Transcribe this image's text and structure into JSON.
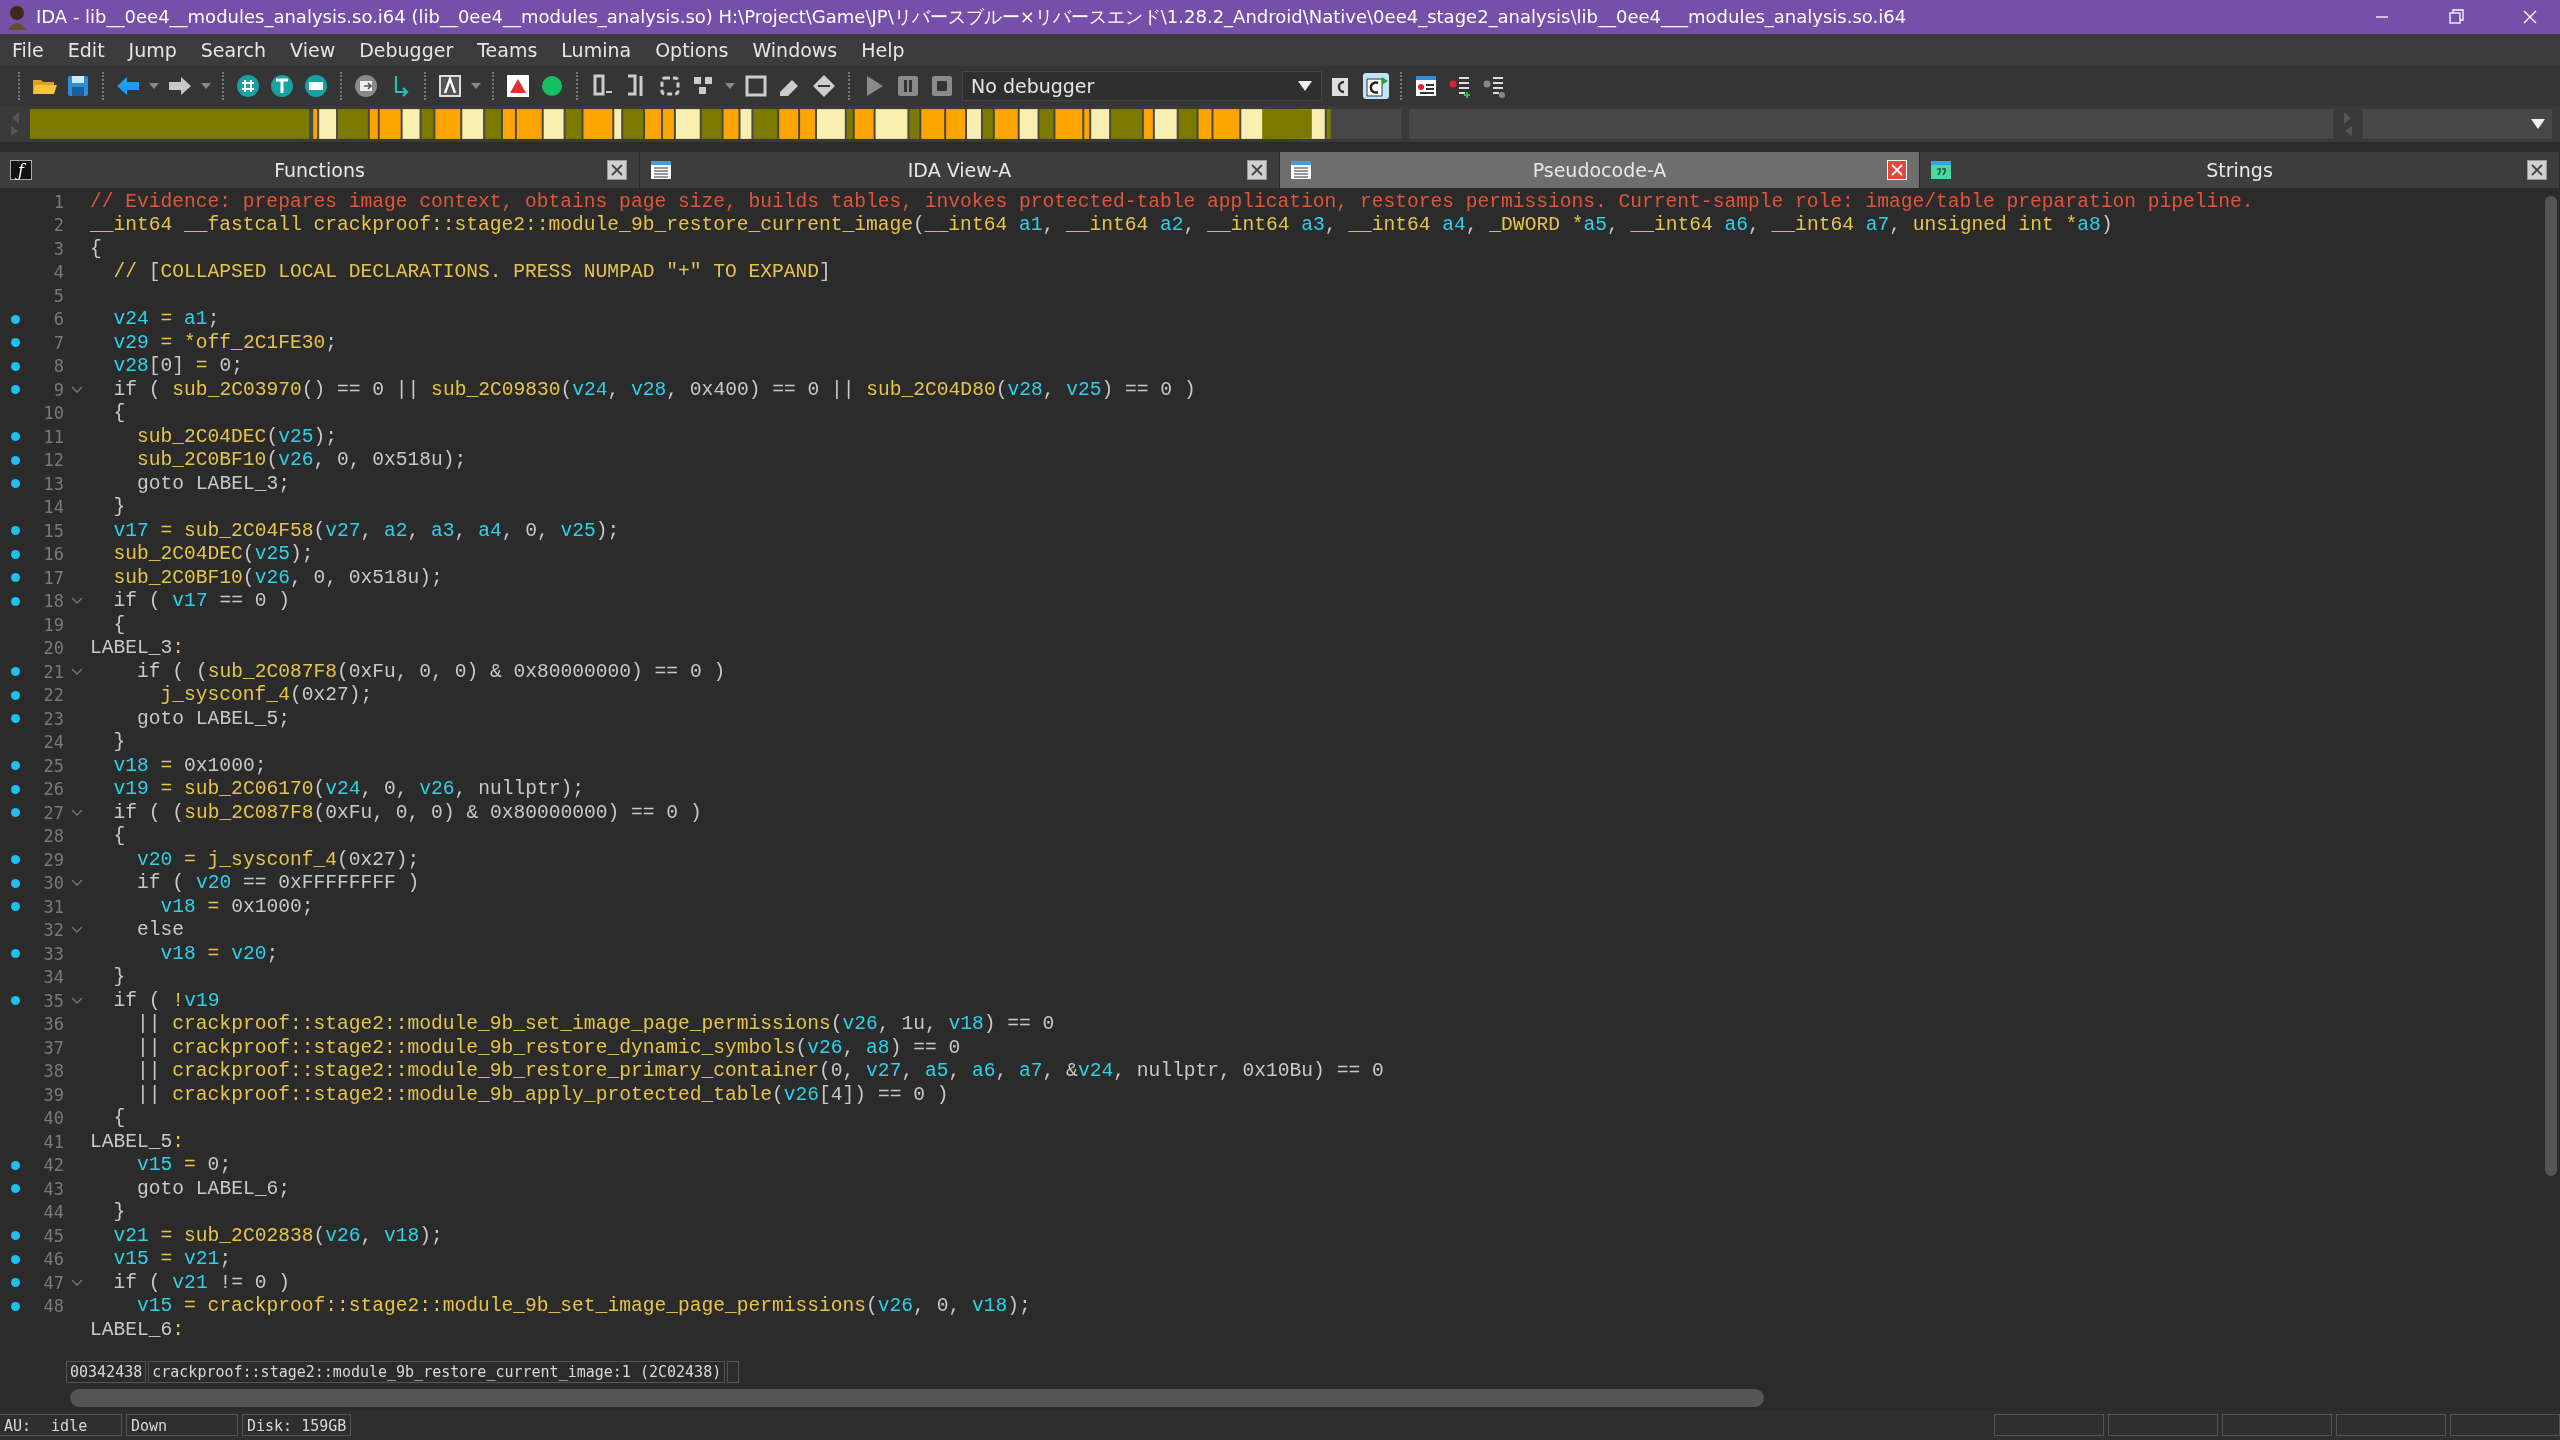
{
  "window": {
    "title": "IDA - lib__0ee4__modules_analysis.so.i64 (lib__0ee4__modules_analysis.so) H:\\Project\\Game\\JP\\リバースブルー×リバースエンド\\1.28.2_Android\\Native\\0ee4_stage2_analysis\\lib__0ee4___modules_analysis.so.i64"
  },
  "menu": [
    "File",
    "Edit",
    "Jump",
    "Search",
    "View",
    "Debugger",
    "Teams",
    "Lumina",
    "Options",
    "Windows",
    "Help"
  ],
  "toolbar": {
    "debugger": "No debugger"
  },
  "tabs": [
    {
      "label": "Functions",
      "kind": "functions",
      "glyph": "ƒ",
      "selected": false
    },
    {
      "label": "IDA View-A",
      "kind": "listing",
      "selected": false
    },
    {
      "label": "Pseudocode-A",
      "kind": "listing",
      "selected": true
    },
    {
      "label": "Strings",
      "kind": "strings",
      "selected": false
    }
  ],
  "code": {
    "lines": [
      {
        "number": "1",
        "kind": "comment",
        "text": "// Evidence: prepares image context, obtains page size, builds tables, invokes protected-table application, restores permissions. Current-sample role: image/table preparation pipeline.",
        "marked": false,
        "foldable": false
      },
      {
        "number": "2",
        "kind": "code",
        "text": "__int64 __fastcall crackproof::stage2::module_9b_restore_current_image(__int64 a1, __int64 a2, __int64 a3, __int64 a4, _DWORD *a5, __int64 a6, __int64 a7, unsigned int *a8)",
        "marked": false,
        "foldable": false
      },
      {
        "number": "3",
        "kind": "code",
        "text": "{",
        "marked": false,
        "foldable": false
      },
      {
        "number": "4",
        "kind": "code",
        "text": "  // [COLLAPSED LOCAL DECLARATIONS. PRESS NUMPAD \"+\" TO EXPAND]",
        "marked": false,
        "foldable": false
      },
      {
        "number": "5",
        "marked": false,
        "foldable": false
      },
      {
        "number": "6",
        "kind": "code",
        "text": "  v24 = a1;",
        "marked": true,
        "foldable": false
      },
      {
        "number": "7",
        "kind": "code",
        "text": "  v29 = *off_2C1FE30;",
        "marked": true,
        "foldable": false
      },
      {
        "number": "8",
        "kind": "code",
        "text": "  v28[0] = 0;",
        "marked": true,
        "foldable": false
      },
      {
        "number": "9",
        "kind": "code",
        "text": "  if ( sub_2C03970() == 0 || sub_2C09830(v24, v28, 0x400) == 0 || sub_2C04D80(v28, v25) == 0 )",
        "marked": true,
        "foldable": true
      },
      {
        "number": "10",
        "kind": "code",
        "text": "  {",
        "marked": false,
        "foldable": false
      },
      {
        "number": "11",
        "kind": "code",
        "text": "    sub_2C04DEC(v25);",
        "marked": true,
        "foldable": false
      },
      {
        "number": "12",
        "kind": "code",
        "text": "    sub_2C0BF10(v26, 0, 0x518u);",
        "marked": true,
        "foldable": false
      },
      {
        "number": "13",
        "kind": "code",
        "text": "    goto LABEL_3;",
        "marked": true,
        "foldable": false
      },
      {
        "number": "14",
        "kind": "code",
        "text": "  }",
        "marked": false,
        "foldable": false
      },
      {
        "number": "15",
        "kind": "code",
        "text": "  v17 = sub_2C04F58(v27, a2, a3, a4, 0, v25);",
        "marked": true,
        "foldable": false
      },
      {
        "number": "16",
        "kind": "code",
        "text": "  sub_2C04DEC(v25);",
        "marked": true,
        "foldable": false
      },
      {
        "number": "17",
        "kind": "code",
        "text": "  sub_2C0BF10(v26, 0, 0x518u);",
        "marked": true,
        "foldable": false
      },
      {
        "number": "18",
        "kind": "code",
        "text": "  if ( v17 == 0 )",
        "marked": true,
        "foldable": true
      },
      {
        "number": "19",
        "kind": "code",
        "text": "  {",
        "marked": false,
        "foldable": false
      },
      {
        "number": "20",
        "kind": "code",
        "text": "LABEL_3:",
        "marked": false,
        "foldable": false
      },
      {
        "number": "21",
        "kind": "code",
        "text": "    if ( (sub_2C087F8(0xFu, 0, 0) & 0x80000000) == 0 )",
        "marked": true,
        "foldable": true
      },
      {
        "number": "22",
        "kind": "code",
        "text": "      j_sysconf_4(0x27);",
        "marked": true,
        "foldable": false
      },
      {
        "number": "23",
        "kind": "code",
        "text": "    goto LABEL_5;",
        "marked": true,
        "foldable": false
      },
      {
        "number": "24",
        "kind": "code",
        "text": "  }",
        "marked": false,
        "foldable": false
      },
      {
        "number": "25",
        "kind": "code",
        "text": "  v18 = 0x1000;",
        "marked": true,
        "foldable": false
      },
      {
        "number": "26",
        "kind": "code",
        "text": "  v19 = sub_2C06170(v24, 0, v26, nullptr);",
        "marked": true,
        "foldable": false
      },
      {
        "number": "27",
        "kind": "code",
        "text": "  if ( (sub_2C087F8(0xFu, 0, 0) & 0x80000000) == 0 )",
        "marked": true,
        "foldable": true
      },
      {
        "number": "28",
        "kind": "code",
        "text": "  {",
        "marked": false,
        "foldable": false
      },
      {
        "number": "29",
        "kind": "code",
        "text": "    v20 = j_sysconf_4(0x27);",
        "marked": true,
        "foldable": false
      },
      {
        "number": "30",
        "kind": "code",
        "text": "    if ( v20 == 0xFFFFFFFF )",
        "marked": true,
        "foldable": true
      },
      {
        "number": "31",
        "kind": "code",
        "text": "      v18 = 0x1000;",
        "marked": true,
        "foldable": false
      },
      {
        "number": "32",
        "kind": "code",
        "text": "    else",
        "marked": false,
        "foldable": true
      },
      {
        "number": "33",
        "kind": "code",
        "text": "      v18 = v20;",
        "marked": true,
        "foldable": false
      },
      {
        "number": "34",
        "kind": "code",
        "text": "  }",
        "marked": false,
        "foldable": false
      },
      {
        "number": "35",
        "kind": "code",
        "text": "  if ( !v19",
        "marked": true,
        "foldable": true
      },
      {
        "number": "36",
        "kind": "code",
        "text": "    || crackproof::stage2::module_9b_set_image_page_permissions(v26, 1u, v18) == 0",
        "marked": false,
        "foldable": false
      },
      {
        "number": "37",
        "kind": "code",
        "text": "    || crackproof::stage2::module_9b_restore_dynamic_symbols(v26, a8) == 0",
        "marked": false,
        "foldable": false
      },
      {
        "number": "38",
        "kind": "code",
        "text": "    || crackproof::stage2::module_9b_restore_primary_container(0, v27, a5, a6, a7, &v24, nullptr, 0x10Bu) == 0",
        "marked": false,
        "foldable": false
      },
      {
        "number": "39",
        "kind": "code",
        "text": "    || crackproof::stage2::module_9b_apply_protected_table(v26[4]) == 0 )",
        "marked": false,
        "foldable": false
      },
      {
        "number": "40",
        "kind": "code",
        "text": "  {",
        "marked": false,
        "foldable": false
      },
      {
        "number": "41",
        "kind": "code",
        "text": "LABEL_5:",
        "marked": false,
        "foldable": false
      },
      {
        "number": "42",
        "kind": "code",
        "text": "    v15 = 0;",
        "marked": true,
        "foldable": false
      },
      {
        "number": "43",
        "kind": "code",
        "text": "    goto LABEL_6;",
        "marked": true,
        "foldable": false
      },
      {
        "number": "44",
        "kind": "code",
        "text": "  }",
        "marked": false,
        "foldable": false
      },
      {
        "number": "45",
        "kind": "code",
        "text": "  v21 = sub_2C02838(v26, v18);",
        "marked": true,
        "foldable": false
      },
      {
        "number": "46",
        "kind": "code",
        "text": "  v15 = v21;",
        "marked": true,
        "foldable": false
      },
      {
        "number": "47",
        "kind": "code",
        "text": "  if ( v21 != 0 )",
        "marked": true,
        "foldable": true
      },
      {
        "number": "48",
        "kind": "code",
        "text": "    v15 = crackproof::stage2::module_9b_set_image_page_permissions(v26, 0, v18);",
        "marked": true,
        "foldable": false
      },
      {
        "kind": "code",
        "text": "LABEL_6:",
        "marked": false,
        "foldable": false
      }
    ]
  },
  "location_bar": {
    "address": "00342438",
    "function": "crackproof::stage2::module_9b_restore_current_image:1 (2C02438)"
  },
  "status_bar": {
    "au_label": "AU:",
    "au_state": "idle",
    "direction": "Down",
    "disk": "Disk: 159GB"
  }
}
